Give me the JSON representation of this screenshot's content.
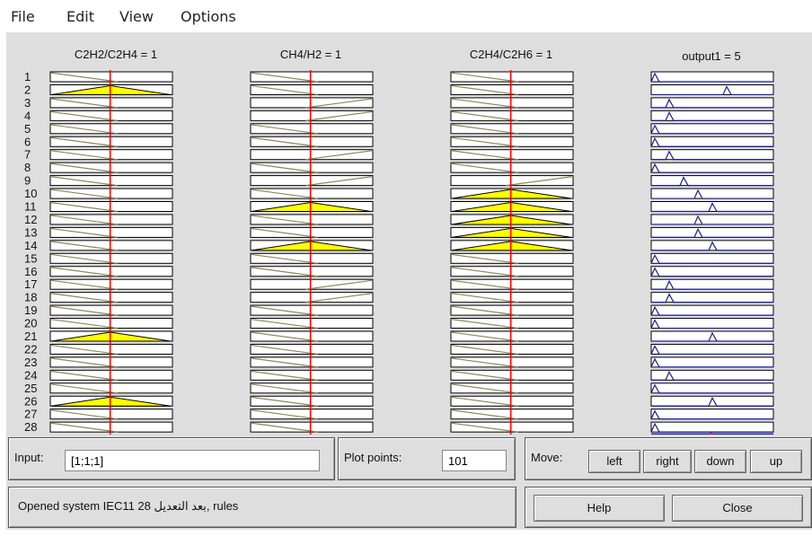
{
  "menu": {
    "file": "File",
    "edit": "Edit",
    "view": "View",
    "options": "Options"
  },
  "columns": [
    {
      "title": "C2H2/C2H4 = 1",
      "kind": "input",
      "mf": [
        "d",
        "t",
        "d",
        "d",
        "d",
        "d",
        "d",
        "d",
        "d",
        "d",
        "d",
        "d",
        "d",
        "d",
        "d",
        "d",
        "d",
        "d",
        "d",
        "d",
        "t",
        "d",
        "d",
        "d",
        "d",
        "t",
        "d",
        "d"
      ]
    },
    {
      "title": "CH4/H2 = 1",
      "kind": "input",
      "mf": [
        "d",
        "d",
        "u",
        "u",
        "d",
        "d",
        "u",
        "d",
        "u",
        "d",
        "t",
        "d",
        "d",
        "t",
        "d",
        "d",
        "u",
        "u",
        "d",
        "d",
        "d",
        "d",
        "d",
        "d",
        "d",
        "d",
        "d",
        "d"
      ]
    },
    {
      "title": "C2H4/C2H6 = 1",
      "kind": "input",
      "mf": [
        "d",
        "d",
        "d",
        "d",
        "d",
        "d",
        "d",
        "d",
        "u",
        "t",
        "t",
        "t",
        "t",
        "t",
        "d",
        "d",
        "d",
        "d",
        "d",
        "d",
        "d",
        "d",
        "d",
        "d",
        "d",
        "d",
        "d",
        "d"
      ]
    },
    {
      "title": "output1 = 5",
      "kind": "output",
      "peaks": [
        0,
        5,
        1,
        1,
        0,
        0,
        1,
        0,
        2,
        3,
        4,
        3,
        3,
        4,
        0,
        0,
        1,
        1,
        0,
        0,
        4,
        0,
        0,
        1,
        0,
        4,
        0,
        0
      ]
    }
  ],
  "rule_numbers": [
    "1",
    "2",
    "3",
    "4",
    "5",
    "6",
    "7",
    "8",
    "9",
    "10",
    "11",
    "12",
    "13",
    "14",
    "15",
    "16",
    "17",
    "18",
    "19",
    "20",
    "21",
    "22",
    "23",
    "24",
    "25",
    "26",
    "27",
    "28"
  ],
  "colors": {
    "fill": "#ffff00",
    "red_line": "#ff0000",
    "output_mf": "#1a1aa8",
    "mf_line": "#8a8a5a"
  },
  "input": {
    "label": "Input:",
    "value": "[1;1;1]"
  },
  "plot_points": {
    "label": "Plot points:",
    "value": "101"
  },
  "move": {
    "label": "Move:",
    "left": "left",
    "right": "right",
    "down": "down",
    "up": "up"
  },
  "status": "Opened system IEC11 28 بعد التعديل, rules",
  "buttons": {
    "help": "Help",
    "close": "Close"
  }
}
